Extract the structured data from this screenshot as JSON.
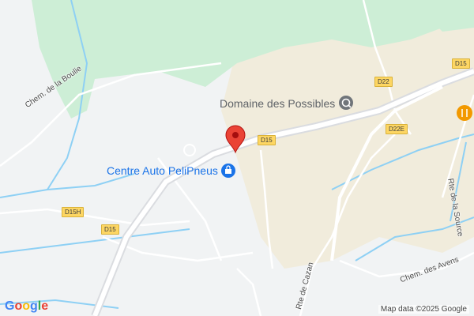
{
  "map": {
    "pois": [
      {
        "name": "Domaine des Possibles",
        "icon": "winery-icon",
        "color": "#70757a"
      },
      {
        "name": "Centre Auto PeliPneus",
        "icon": "shopping-bag-icon",
        "color": "#1a73e8"
      }
    ],
    "selected_marker": {
      "icon": "red-pin-icon",
      "color": "#ea4335"
    },
    "restaurant_marker": {
      "icon": "fork-knife-icon",
      "color": "#f29900"
    },
    "road_badges": [
      "D15",
      "D22",
      "D15",
      "D22E",
      "D15H",
      "D15"
    ],
    "street_labels": [
      "Chem. de la Boulie",
      "Rte de la Source",
      "Rte de Cazan",
      "Chem. des Avens"
    ],
    "attribution": "Map data ©2025 Google",
    "logo": {
      "letters": [
        "G",
        "o",
        "o",
        "g",
        "l",
        "e"
      ],
      "colors": [
        "#4285f4",
        "#ea4335",
        "#fbbc05",
        "#4285f4",
        "#34a853",
        "#ea4335"
      ]
    },
    "colors": {
      "park": "#cdeed6",
      "farmland": "#f1ecdc",
      "urban": "#f1f3f4",
      "road": "#ffffff",
      "highway": "#dadce0",
      "water": "#8ed0f4"
    }
  }
}
